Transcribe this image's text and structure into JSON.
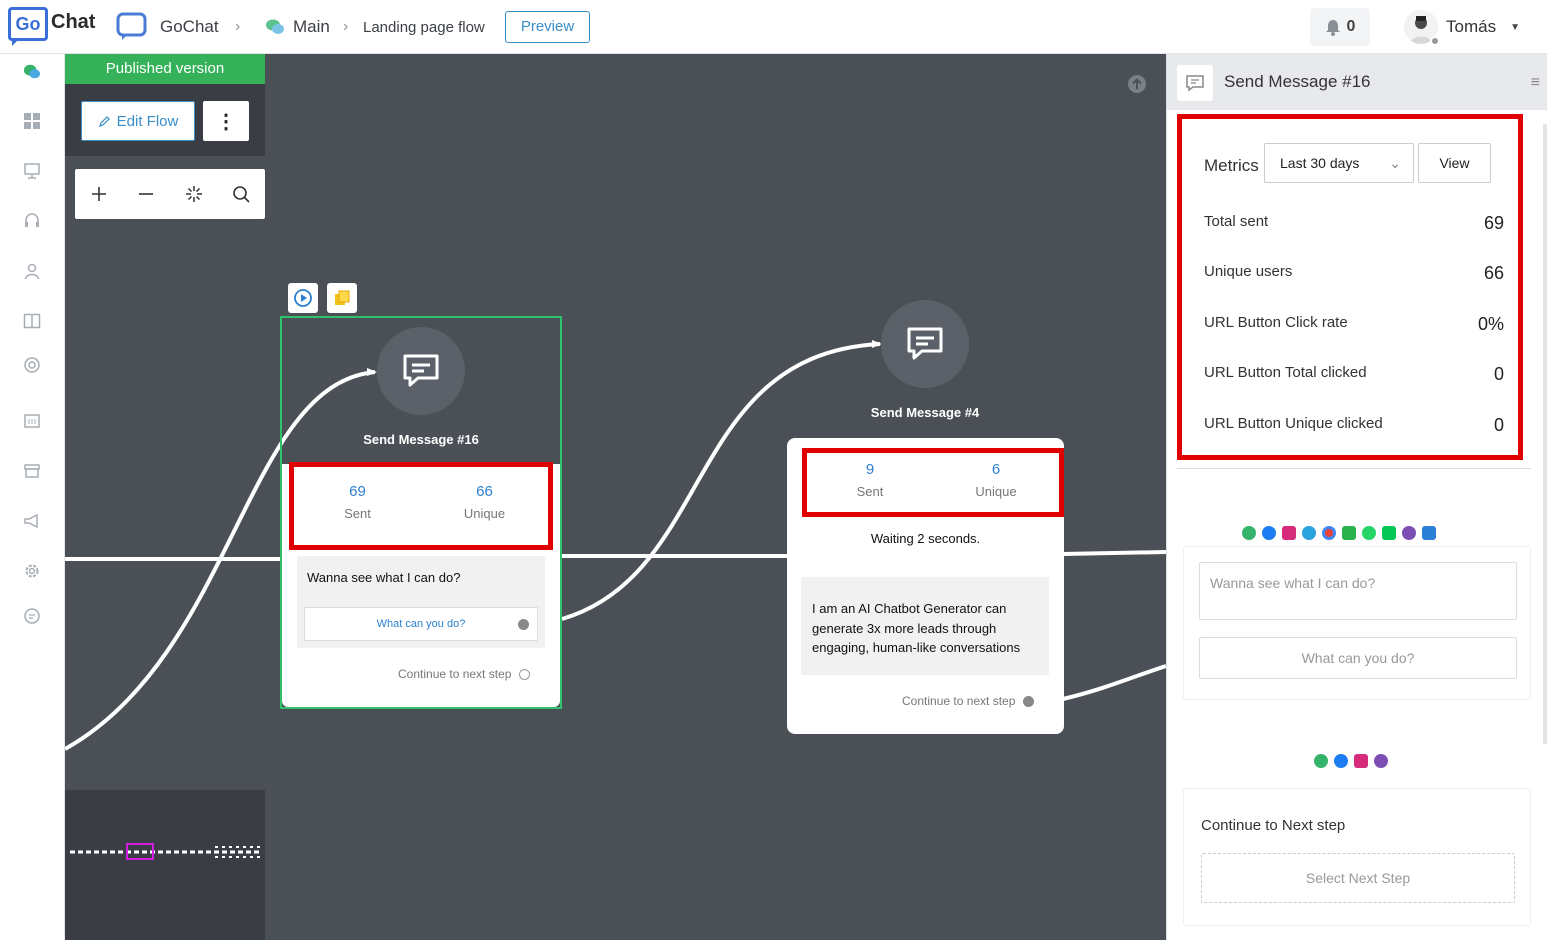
{
  "header": {
    "logo_text": "Go",
    "logo_text2": "Chat",
    "workspace": "GoChat",
    "folder": "Main",
    "flow_name": "Landing page flow",
    "preview_label": "Preview",
    "notification_count": "0",
    "user_name": "Tomás"
  },
  "toolbar": {
    "published_label": "Published version",
    "edit_flow_label": "Edit Flow"
  },
  "nodes": {
    "node1": {
      "title": "Send Message #16",
      "sent_value": "69",
      "sent_label": "Sent",
      "unique_value": "66",
      "unique_label": "Unique",
      "message": "Wanna see what I can do?",
      "quick_reply": "What can you do?",
      "continue_label": "Continue to next step"
    },
    "node2": {
      "title": "Send Message #4",
      "sent_value": "9",
      "sent_label": "Sent",
      "unique_value": "6",
      "unique_label": "Unique",
      "waiting": "Waiting 2 seconds.",
      "message": "I am an AI Chatbot Generator can generate 3x more leads through engaging, human-like conversations",
      "continue_label": "Continue to next step"
    }
  },
  "panel": {
    "title": "Send Message #16",
    "metrics_label": "Metrics",
    "period": "Last 30 days",
    "view_label": "View",
    "metrics": [
      {
        "label": "Total sent",
        "value": "69"
      },
      {
        "label": "Unique users",
        "value": "66"
      },
      {
        "label": "URL Button Click rate",
        "value": "0%"
      },
      {
        "label": "URL Button Total clicked",
        "value": "0"
      },
      {
        "label": "URL Button Unique clicked",
        "value": "0"
      }
    ],
    "message_placeholder": "Wanna see what I can do?",
    "quick_reply": "What can you do?",
    "continue_title": "Continue to Next step",
    "select_next_step": "Select Next Step",
    "channel_icons_row1": [
      "wechat-icon",
      "messenger-icon",
      "instagram-icon",
      "telegram-icon",
      "google-icon",
      "wechat-green-icon",
      "whatsapp-icon",
      "line-icon",
      "viber-icon",
      "vk-icon"
    ],
    "channel_icons_row2": [
      "wechat-icon",
      "messenger-icon",
      "instagram-icon",
      "viber-icon"
    ]
  },
  "colors": {
    "accent": "#3a8fc8",
    "published_green": "#34b159",
    "highlight_red": "#e00000",
    "canvas_bg": "#4b5057"
  }
}
